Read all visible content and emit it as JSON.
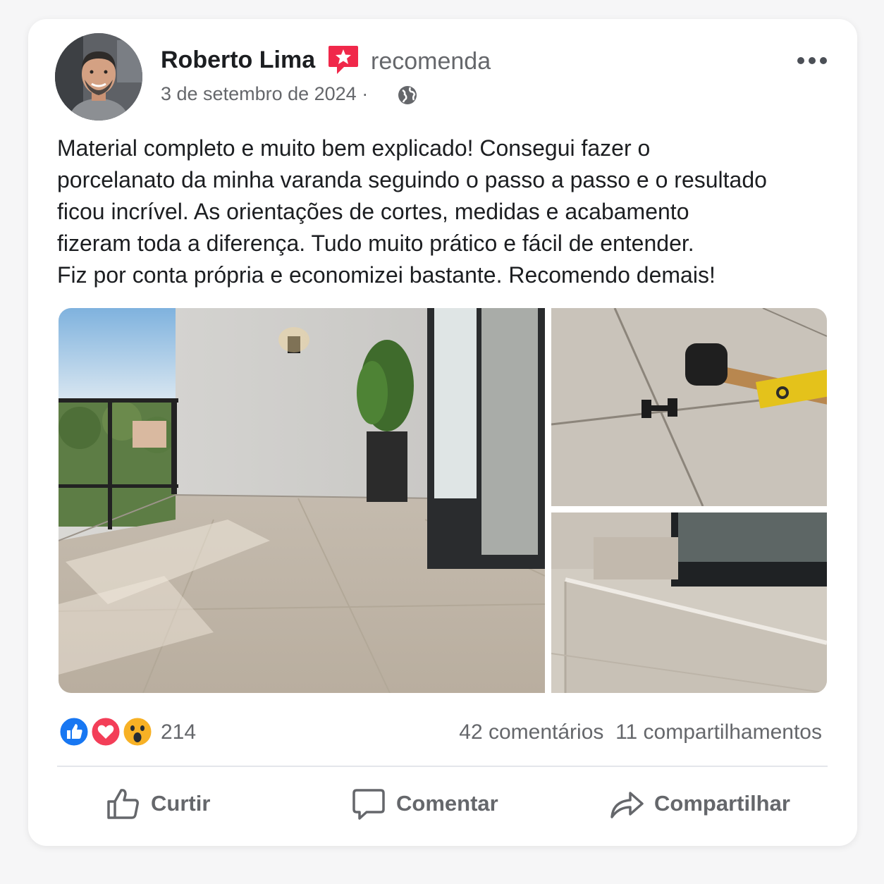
{
  "post": {
    "author": "Roberto Lima",
    "action": "recomenda",
    "date": "3 de setembro de 2024 ·",
    "audience_icon": "globe-icon",
    "text_lines": [
      "Material completo e muito bem explicado! Consegui fazer o",
      "porcelanato da minha varanda seguindo o passo a passo e o resultado",
      "ficou incrível. As orientações de cortes, medidas e acabamento",
      "fizeram toda a diferença. Tudo muito prático e fácil de entender.",
      "Fiz por conta própria e economizei bastante. Recomendo demais!"
    ]
  },
  "reactions": {
    "icons": [
      "like-icon",
      "love-icon",
      "wow-icon"
    ],
    "count": "214",
    "comments": "42 comentários",
    "shares": "11 compartilhamentos"
  },
  "actions": {
    "like": "Curtir",
    "comment": "Comentar",
    "share": "Compartilhar"
  },
  "colors": {
    "like_blue": "#1877f2",
    "love_red": "#f33e58",
    "wow_yellow": "#f7b125",
    "recommend_badge": "#f0284a",
    "text_primary": "#1c1e21",
    "text_secondary": "#65676b"
  }
}
